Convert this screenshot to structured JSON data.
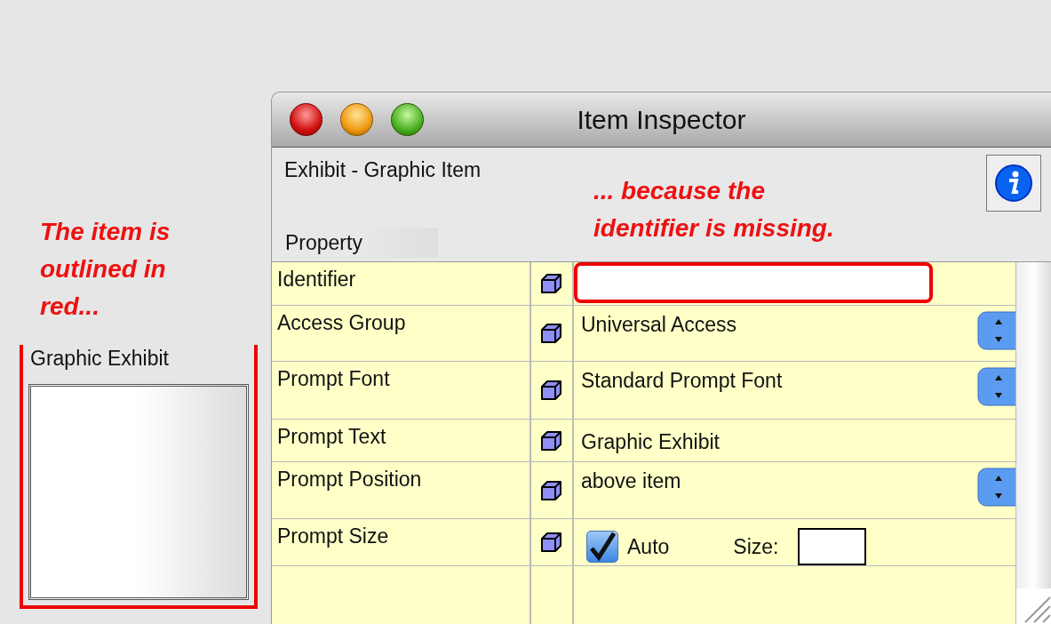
{
  "left_note": "The item is outlined in red...",
  "exhibit": {
    "prompt": "Graphic Exhibit",
    "error": true
  },
  "window": {
    "title": "Item Inspector",
    "subtitle": "Exhibit - Graphic Item",
    "column_header": "Property",
    "note": "... because the identifier is missing."
  },
  "rows": [
    {
      "property": "Identifier",
      "kind": "field",
      "value": "",
      "error": true
    },
    {
      "property": "Access Group",
      "kind": "popup",
      "value": "Universal Access"
    },
    {
      "property": "Prompt Font",
      "kind": "popup",
      "value": "Standard Prompt Font"
    },
    {
      "property": "Prompt Text",
      "kind": "text",
      "value": "Graphic Exhibit"
    },
    {
      "property": "Prompt Position",
      "kind": "popup",
      "value": "above item"
    },
    {
      "property": "Prompt Size",
      "kind": "size",
      "checked": true,
      "check_label": "Auto",
      "size_label": "Size:"
    }
  ]
}
